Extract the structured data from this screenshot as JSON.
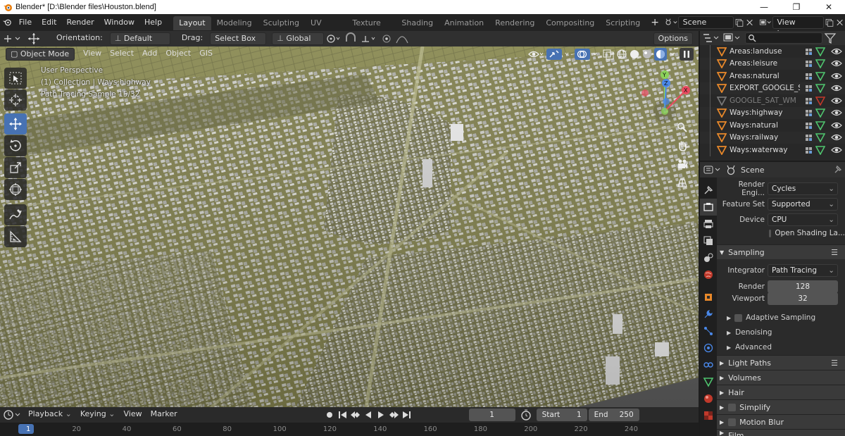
{
  "titlebar": {
    "title": "Blender* [D:\\Blender files\\Houston.blend]",
    "minimize": "—",
    "maximize": "❐",
    "close": "✕"
  },
  "topbar": {
    "menus": [
      "File",
      "Edit",
      "Render",
      "Window",
      "Help"
    ],
    "workspaces": [
      "Layout",
      "Modeling",
      "Sculpting",
      "UV Editing",
      "Texture Paint",
      "Shading",
      "Animation",
      "Rendering",
      "Compositing",
      "Scripting"
    ],
    "active_workspace": "Layout",
    "add_workspace": "+",
    "scene": "Scene",
    "view_layer": "View Layer"
  },
  "viewport_header": {
    "orientation_label": "Orientation:",
    "orientation_value": "Default",
    "drag_label": "Drag:",
    "drag_value": "Select Box",
    "transform_value": "Global",
    "options": "Options"
  },
  "viewport_header2": {
    "mode": "Object Mode",
    "menus": [
      "View",
      "Select",
      "Add",
      "Object",
      "GIS"
    ]
  },
  "viewport_overlay": {
    "line1": "User Perspective",
    "line2": "(1) Collection | Ways:highway",
    "line3": "Path Tracing Sample 15/32"
  },
  "gizmo": {
    "x": "X",
    "y": "Y",
    "z": "Z"
  },
  "outliner": {
    "items": [
      {
        "name": "Areas:landuse",
        "dim": false
      },
      {
        "name": "Areas:leisure",
        "dim": false
      },
      {
        "name": "Areas:natural",
        "dim": false
      },
      {
        "name": "EXPORT_GOOGLE_SAT_WM",
        "dim": false
      },
      {
        "name": "GOOGLE_SAT_WM",
        "dim": true
      },
      {
        "name": "Ways:highway",
        "dim": false
      },
      {
        "name": "Ways:natural",
        "dim": false
      },
      {
        "name": "Ways:railway",
        "dim": false
      },
      {
        "name": "Ways:waterway",
        "dim": false
      }
    ]
  },
  "properties": {
    "context": "Scene",
    "render_engine_label": "Render Engi...",
    "render_engine_value": "Cycles",
    "feature_set_label": "Feature Set",
    "feature_set_value": "Supported",
    "device_label": "Device",
    "device_value": "CPU",
    "osl_label": "Open Shading La...",
    "sampling": "Sampling",
    "integrator_label": "Integrator",
    "integrator_value": "Path Tracing",
    "render_label": "Render",
    "render_value": "128",
    "viewport_label": "Viewport",
    "viewport_value": "32",
    "adaptive_sampling": "Adaptive Sampling",
    "denoising": "Denoising",
    "advanced": "Advanced",
    "light_paths": "Light Paths",
    "volumes": "Volumes",
    "hair": "Hair",
    "simplify": "Simplify",
    "motion_blur": "Motion Blur",
    "film": "Film"
  },
  "timeline": {
    "menus": [
      "Playback",
      "Keying",
      "View",
      "Marker"
    ],
    "current_frame": "1",
    "start_label": "Start",
    "start_value": "1",
    "end_label": "End",
    "end_value": "250",
    "ticks": [
      "1",
      "20",
      "40",
      "60",
      "80",
      "100",
      "120",
      "140",
      "160",
      "180",
      "200",
      "220",
      "240"
    ]
  },
  "colors": {
    "accent": "#4772b3",
    "ground": "#7f7f4a",
    "building": "#cfcfcf",
    "collection_icon": "#e8882a",
    "mesh_icon": "#4fc46e"
  }
}
